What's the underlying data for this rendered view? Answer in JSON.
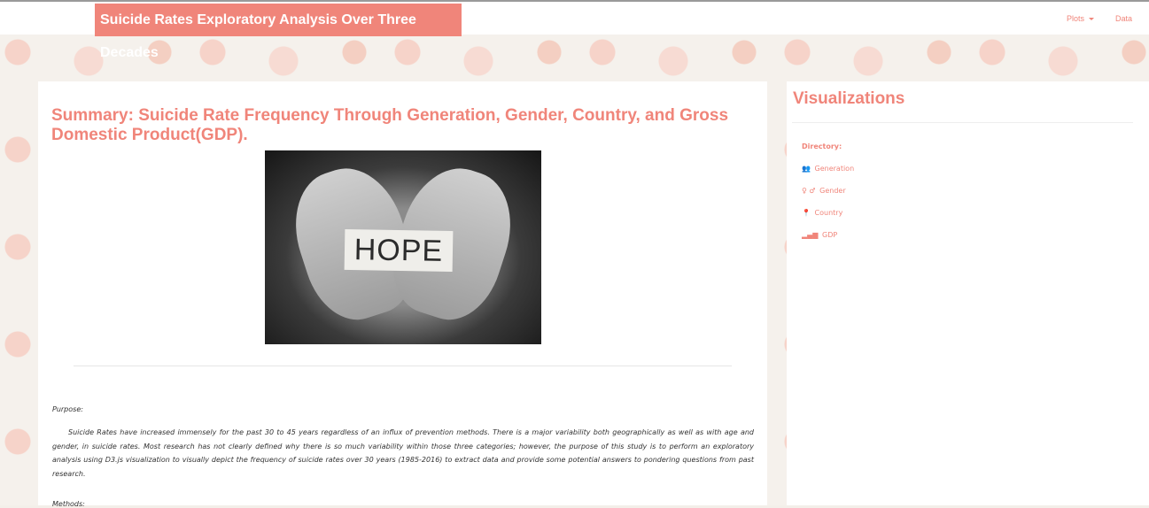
{
  "header": {
    "brand": "Suicide Rates Exploratory Analysis Over Three Decades",
    "nav_plots": "Plots",
    "nav_data": "Data"
  },
  "main": {
    "title": "Summary: Suicide Rate Frequency Through Generation, Gender, Country, and Gross Domestic Product(GDP).",
    "image_text": "HOPE",
    "purpose_label": "Purpose:",
    "purpose_text": "Suicide Rates have increased immensely for the past 30 to 45 years regardless of an influx of prevention methods. There is a major variability both geographically as well as with age and gender, in suicide rates. Most research has not clearly defined why there is so much variability within those three categories; however, the purpose of this study is to perform an exploratory analysis using D3.js visualization to visually depict the frequency of suicide rates over 30 years (1985-2016) to extract data and provide some potential answers to pondering questions from past research.",
    "methods_label": "Methods:"
  },
  "sidebar": {
    "title": "Visualizations",
    "directory_label": "Directory:",
    "items": [
      {
        "icon": "people-icon",
        "glyph": "👥",
        "label": "Generation"
      },
      {
        "icon": "gender-icon",
        "glyph": "♀ ♂",
        "label": "Gender"
      },
      {
        "icon": "map-marker-icon",
        "glyph": "📍",
        "label": "Country"
      },
      {
        "icon": "signal-icon",
        "glyph": "▂▄▆",
        "label": "GDP"
      }
    ]
  },
  "colors": {
    "accent": "#f0857a"
  }
}
